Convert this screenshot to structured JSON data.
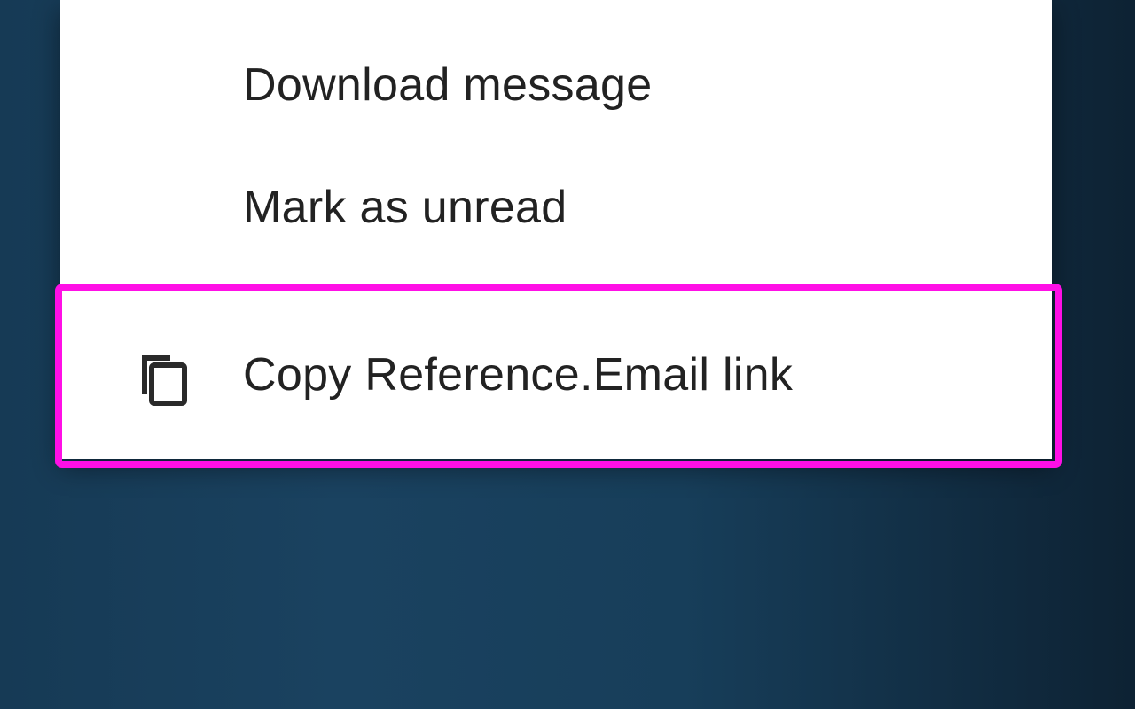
{
  "menu": {
    "items": [
      {
        "label": "Download message",
        "icon": ""
      },
      {
        "label": "Mark as unread",
        "icon": ""
      },
      {
        "label": "Copy Reference.Email link",
        "icon": "copy-icon"
      }
    ]
  },
  "colors": {
    "highlight_border": "#ff0fe6",
    "menu_background": "#ffffff",
    "text": "#222222"
  }
}
